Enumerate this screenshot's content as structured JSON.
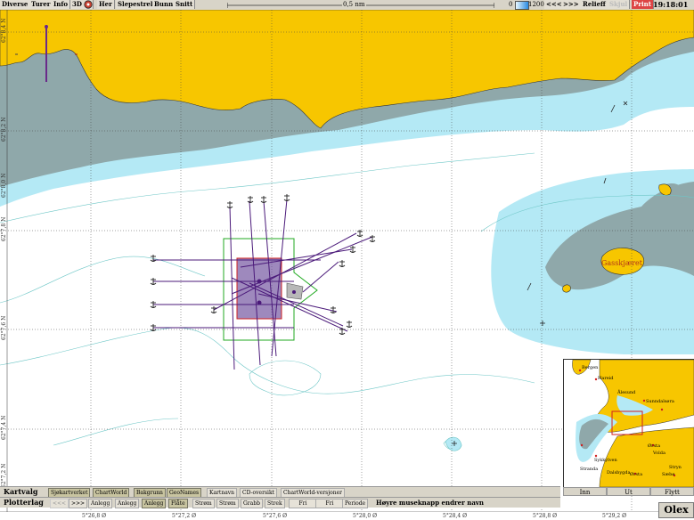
{
  "toolbar": {
    "menu": [
      "Diverse",
      "Turer",
      "Info",
      "3D"
    ],
    "buttons": [
      "Her",
      "Slepestrek",
      "Bunn",
      "Snitt"
    ],
    "scale_label": "0,5 nm",
    "depth_min": "0",
    "depth_max": "1200",
    "nav_back": "<<<",
    "nav_fwd": ">>>",
    "relief": "Relieff",
    "hide": "Skjul",
    "print": "Print",
    "clock": "19:18:01"
  },
  "chart": {
    "lat_labels": [
      "62°8,4 N",
      "62°8,2 N",
      "62°8,0 N",
      "62°7,8 N",
      "62°7,6 N",
      "62°7,4 N",
      "62°7,2 N"
    ],
    "lon_labels": [
      "5°26,8 Ø",
      "5°27,2 Ø",
      "5°27,6 Ø",
      "5°28,0 Ø",
      "5°28,4 Ø",
      "5°28,8 Ø",
      "5°29,2 Ø"
    ],
    "place_name": "Gasskjæret",
    "colors": {
      "land": "#f7c600",
      "shallow": "#8fa8aa",
      "mid": "#b4e9f5",
      "deep": "#ffffff",
      "track": "#4b1a7a",
      "polygon": "#22aa22",
      "area_fill": "#6a4a9a"
    }
  },
  "kartvalg": {
    "title": "Kartvalg",
    "buttons": [
      "Sjøkartverket",
      "ChartWorld",
      "Bakgrunn",
      "GeoNames",
      "Kartnavn",
      "CD-oversikt",
      "ChartWorld-versjoner"
    ]
  },
  "plotterlag": {
    "title": "Plotterlag",
    "nav_back": "<<<",
    "nav_fwd": ">>>",
    "buttons": [
      "Anlegg",
      "Anlegg",
      "Anlegg",
      "Flåte",
      "Strøm",
      "Strøm",
      "Grabb",
      "Strek",
      "Fri",
      "Fri",
      "Periode"
    ],
    "hint": "Høyre museknapp endrer navn"
  },
  "minimap": {
    "labels": [
      "Bergen",
      "Hareid",
      "Ålesund",
      "Sunndalsøra",
      "Ørsta",
      "Volda",
      "Stryn",
      "Sykkylven",
      "Stranda",
      "Dalsbygda",
      "Ørsta",
      "Sæbø",
      "Innvik",
      "Sandane",
      "Oppdal",
      "Kvam",
      "Surnadal",
      "Ålesund",
      "Molde"
    ],
    "btn_in": "Inn",
    "btn_out": "Ut",
    "btn_move": "Flytt"
  },
  "brand": "Olex"
}
